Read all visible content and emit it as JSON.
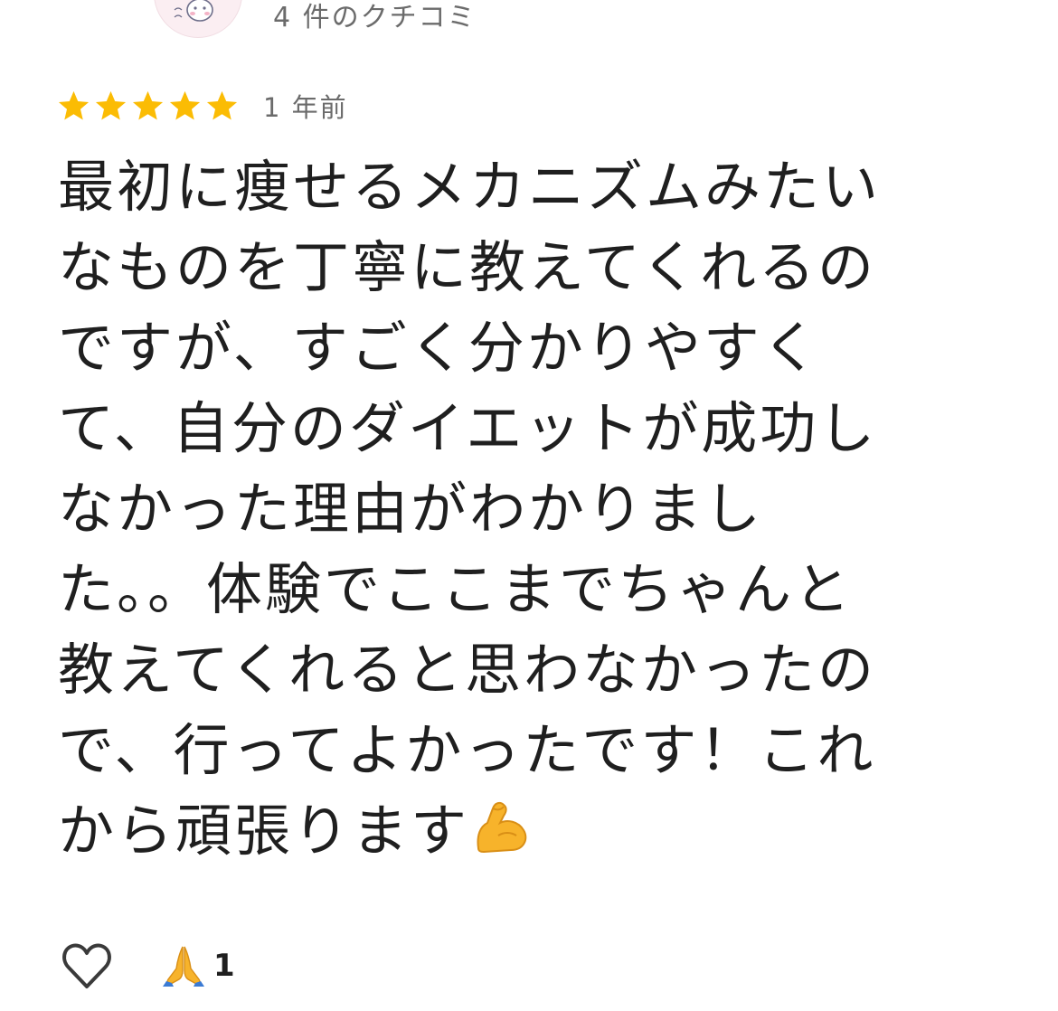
{
  "header": {
    "close_icon": "close-icon",
    "avatar_icon": "rabbit-avatar-icon",
    "review_count": "4 件のクチコミ"
  },
  "review": {
    "rating": 5,
    "max_rating": 5,
    "star_color": "#FBBC04",
    "time_ago": "1 年前",
    "lines": [
      "最初に痩せるメカニズムみたい",
      "なものを丁寧に教えてくれるの",
      "ですが、すごく分かりやすく",
      "て、自分のダイエットが成功し",
      "なかった理由がわかりまし",
      "た。。体験でここまでちゃんと",
      "教えてくれると思わなかったの",
      "で、行ってよかったです！これ",
      "から頑張ります"
    ],
    "trailing_emoji": "flexed-biceps-icon"
  },
  "actions": {
    "like_icon": "heart-outline-icon",
    "reaction_icon": "folded-hands-icon",
    "reaction_count": "1"
  }
}
